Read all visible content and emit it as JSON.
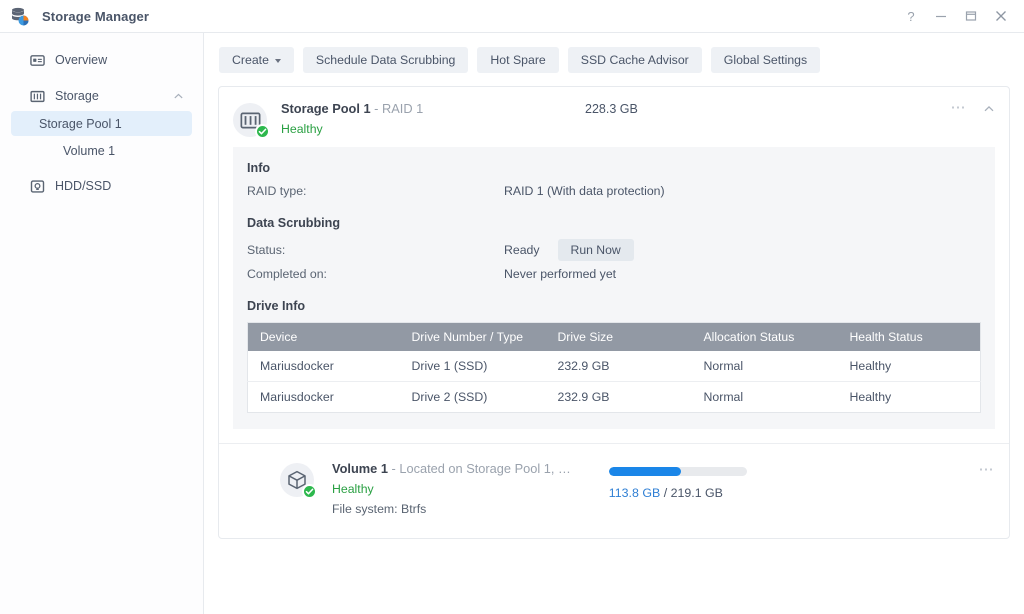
{
  "window": {
    "app_title": "Storage Manager",
    "app_icon": "storage-manager-icon",
    "controls": {
      "help": "?",
      "minimize": "minimize-icon",
      "maximize": "maximize-icon",
      "close": "close-icon"
    }
  },
  "sidebar": {
    "items": [
      {
        "label": "Overview",
        "icon": "overview-icon"
      },
      {
        "label": "Storage",
        "icon": "storage-icon",
        "expanded": true
      },
      {
        "label": "HDD/SSD",
        "icon": "hdd-ssd-icon"
      }
    ],
    "storage_children": [
      {
        "label": "Storage Pool 1",
        "selected": true
      },
      {
        "label": "Volume 1",
        "selected": false
      }
    ]
  },
  "toolbar": {
    "create_label": "Create",
    "schedule_label": "Schedule Data Scrubbing",
    "hot_spare_label": "Hot Spare",
    "ssd_cache_label": "SSD Cache Advisor",
    "global_settings_label": "Global Settings"
  },
  "pool": {
    "name": "Storage Pool 1",
    "raid_suffix": "- RAID 1",
    "size": "228.3 GB",
    "status": "Healthy",
    "info_heading": "Info",
    "raid_type_key": "RAID type:",
    "raid_type_val": "RAID 1 (With data protection)",
    "scrub_heading": "Data Scrubbing",
    "status_key": "Status:",
    "status_val": "Ready",
    "run_now_label": "Run Now",
    "completed_key": "Completed on:",
    "completed_val": "Never performed yet",
    "drive_info_heading": "Drive Info",
    "table": {
      "columns": [
        "Device",
        "Drive Number / Type",
        "Drive Size",
        "Allocation Status",
        "Health Status"
      ],
      "rows": [
        [
          "Mariusdocker",
          "Drive 1 (SSD)",
          "232.9 GB",
          "Normal",
          "Healthy"
        ],
        [
          "Mariusdocker",
          "Drive 2 (SSD)",
          "232.9 GB",
          "Normal",
          "Healthy"
        ]
      ]
    }
  },
  "volume": {
    "name": "Volume 1",
    "location_suffix": "- Located on Storage Pool 1, …",
    "status": "Healthy",
    "filesystem": "File system: Btrfs",
    "used": "113.8 GB",
    "separator": "/",
    "total": "219.1 GB",
    "usage_percent": 52
  },
  "colors": {
    "accent_blue": "#1a86e8",
    "healthy_green": "#2aa043",
    "badge_green": "#2db84d",
    "panel_gray": "#f5f6f8",
    "table_header_gray": "#9299a4",
    "selected_nav": "#e3effb",
    "text": "#4a5568",
    "muted": "#9aa2ad"
  }
}
